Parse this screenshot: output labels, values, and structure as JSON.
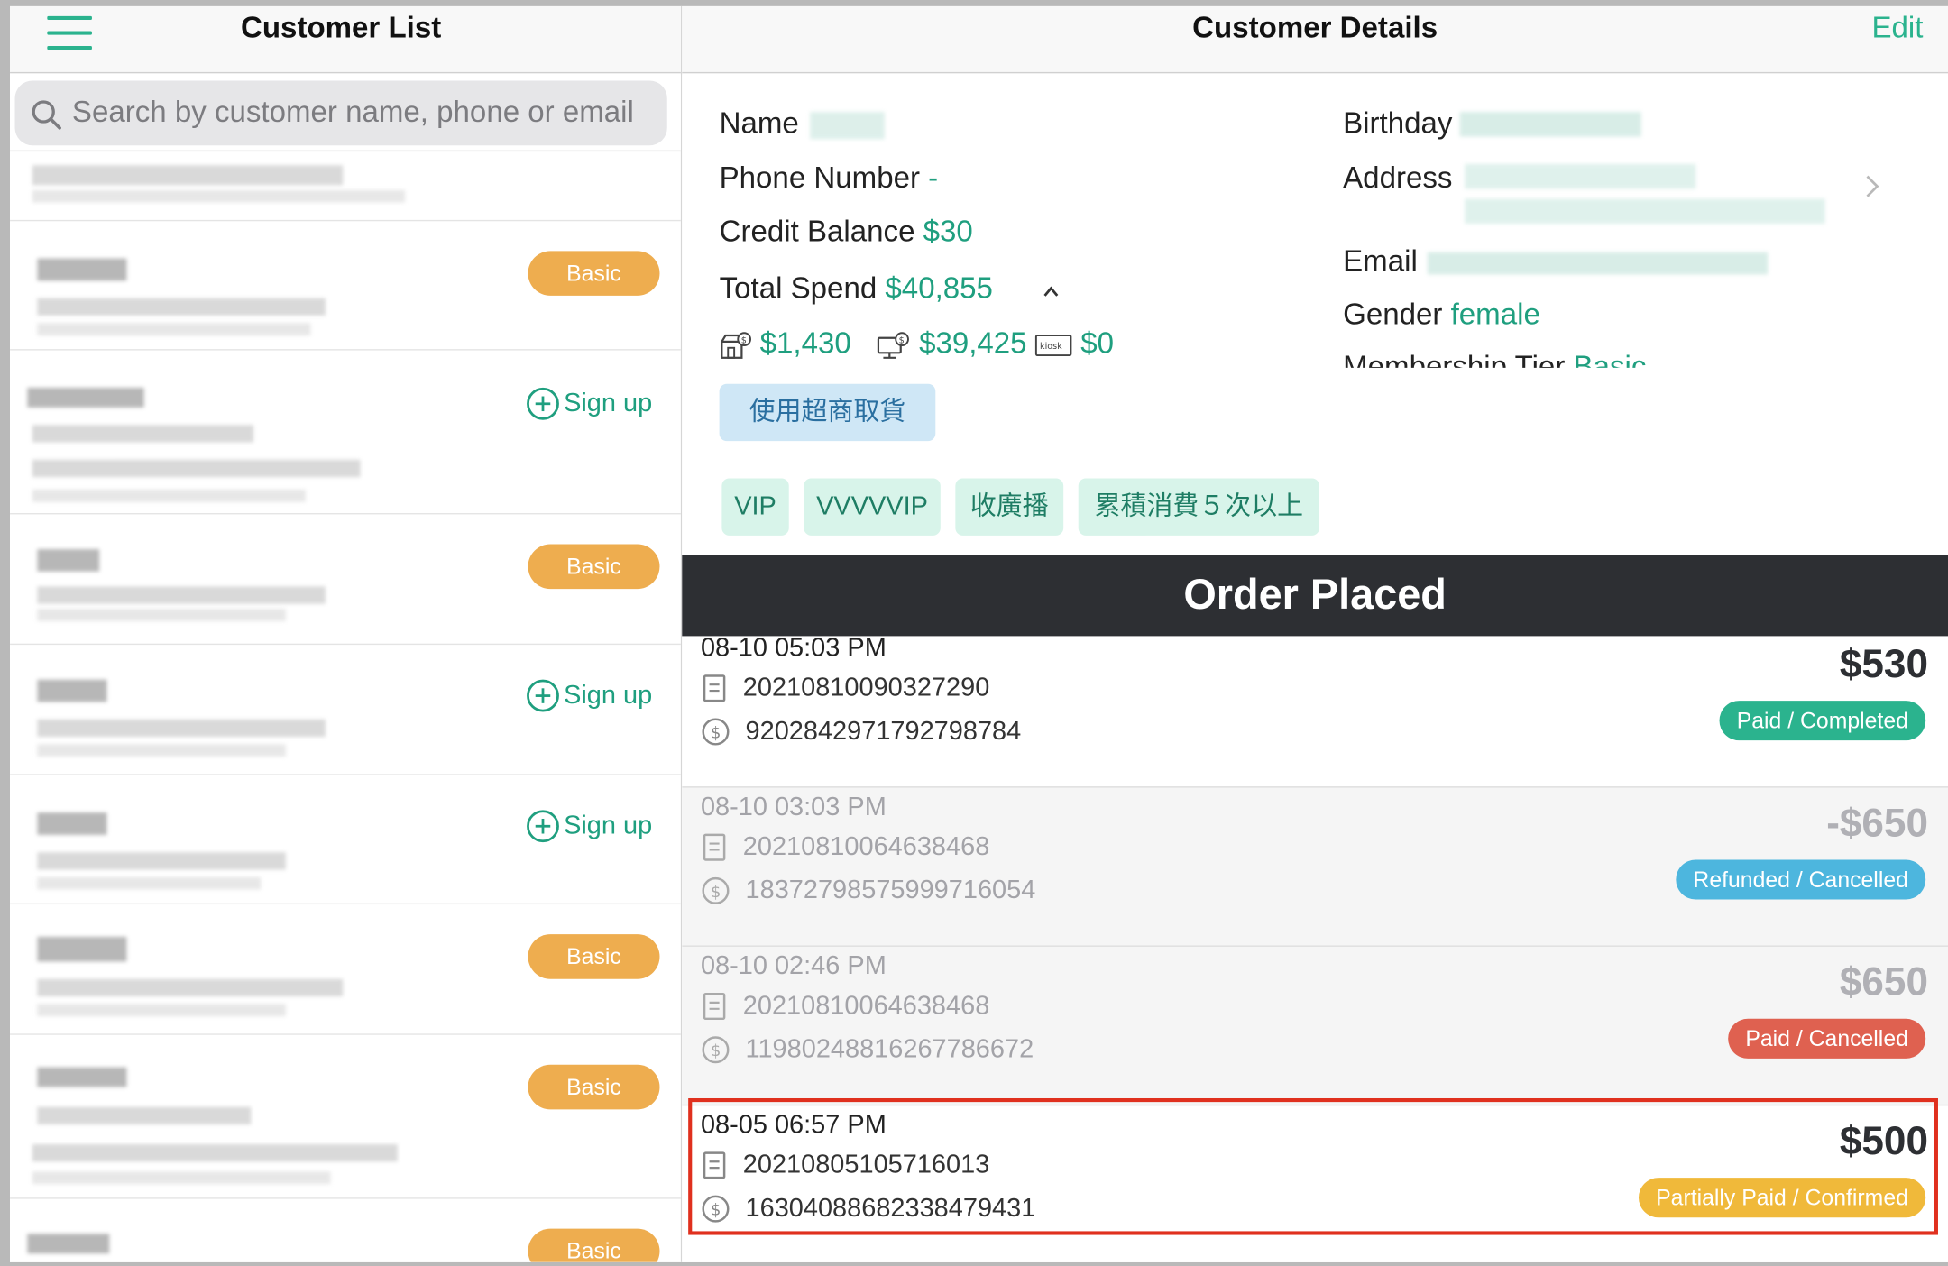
{
  "left_panel": {
    "title": "Customer List",
    "search_placeholder": "Search by customer name, phone or email",
    "rows": [
      {
        "badge": "",
        "signup": ""
      },
      {
        "badge": "Basic",
        "signup": ""
      },
      {
        "badge": "",
        "signup": "Sign up"
      },
      {
        "badge": "Basic",
        "signup": ""
      },
      {
        "badge": "",
        "signup": "Sign up"
      },
      {
        "badge": "",
        "signup": "Sign up"
      },
      {
        "badge": "Basic",
        "signup": ""
      },
      {
        "badge": "Basic",
        "signup": ""
      },
      {
        "badge": "Basic",
        "signup": ""
      }
    ]
  },
  "right_panel": {
    "title": "Customer Details",
    "edit_label": "Edit",
    "fields": {
      "name_label": "Name",
      "phone_label": "Phone Number",
      "phone_value": "-",
      "credit_label": "Credit Balance",
      "credit_value": "$30",
      "spend_label": "Total Spend",
      "spend_value": "$40,855",
      "spend_breakdown": [
        "$1,430",
        "$39,425",
        "$0"
      ],
      "kiosk_label": "kiosk",
      "birthday_label": "Birthday",
      "address_label": "Address",
      "email_label": "Email",
      "gender_label": "Gender",
      "gender_value": "female",
      "tier_label": "Membership Tier",
      "tier_value": "Basic"
    },
    "pickup_button": "使用超商取貨",
    "tags": [
      "VIP",
      "VVVVVIP",
      "收廣播",
      "累積消費５次以上"
    ],
    "orders_header": "Order Placed",
    "orders": [
      {
        "datetime": "08-10 05:03 PM",
        "order_no": "20210810090327290",
        "payment_no": "9202842971792798784",
        "amount": "$530",
        "status": "Paid / Completed",
        "status_color": "#2bb38e"
      },
      {
        "datetime": "08-10 03:03 PM",
        "order_no": "20210810064638468",
        "payment_no": "18372798575999716054",
        "amount": "-$650",
        "status": "Refunded / Cancelled",
        "status_color": "#4db6de"
      },
      {
        "datetime": "08-10 02:46 PM",
        "order_no": "20210810064638468",
        "payment_no": "11980248816267786672",
        "amount": "$650",
        "status": "Paid / Cancelled",
        "status_color": "#df6150"
      },
      {
        "datetime": "08-05 06:57 PM",
        "order_no": "20210805105716013",
        "payment_no": "16304088682338479431",
        "amount": "$500",
        "status": "Partially Paid / Confirmed",
        "status_color": "#f0b93a"
      }
    ]
  }
}
